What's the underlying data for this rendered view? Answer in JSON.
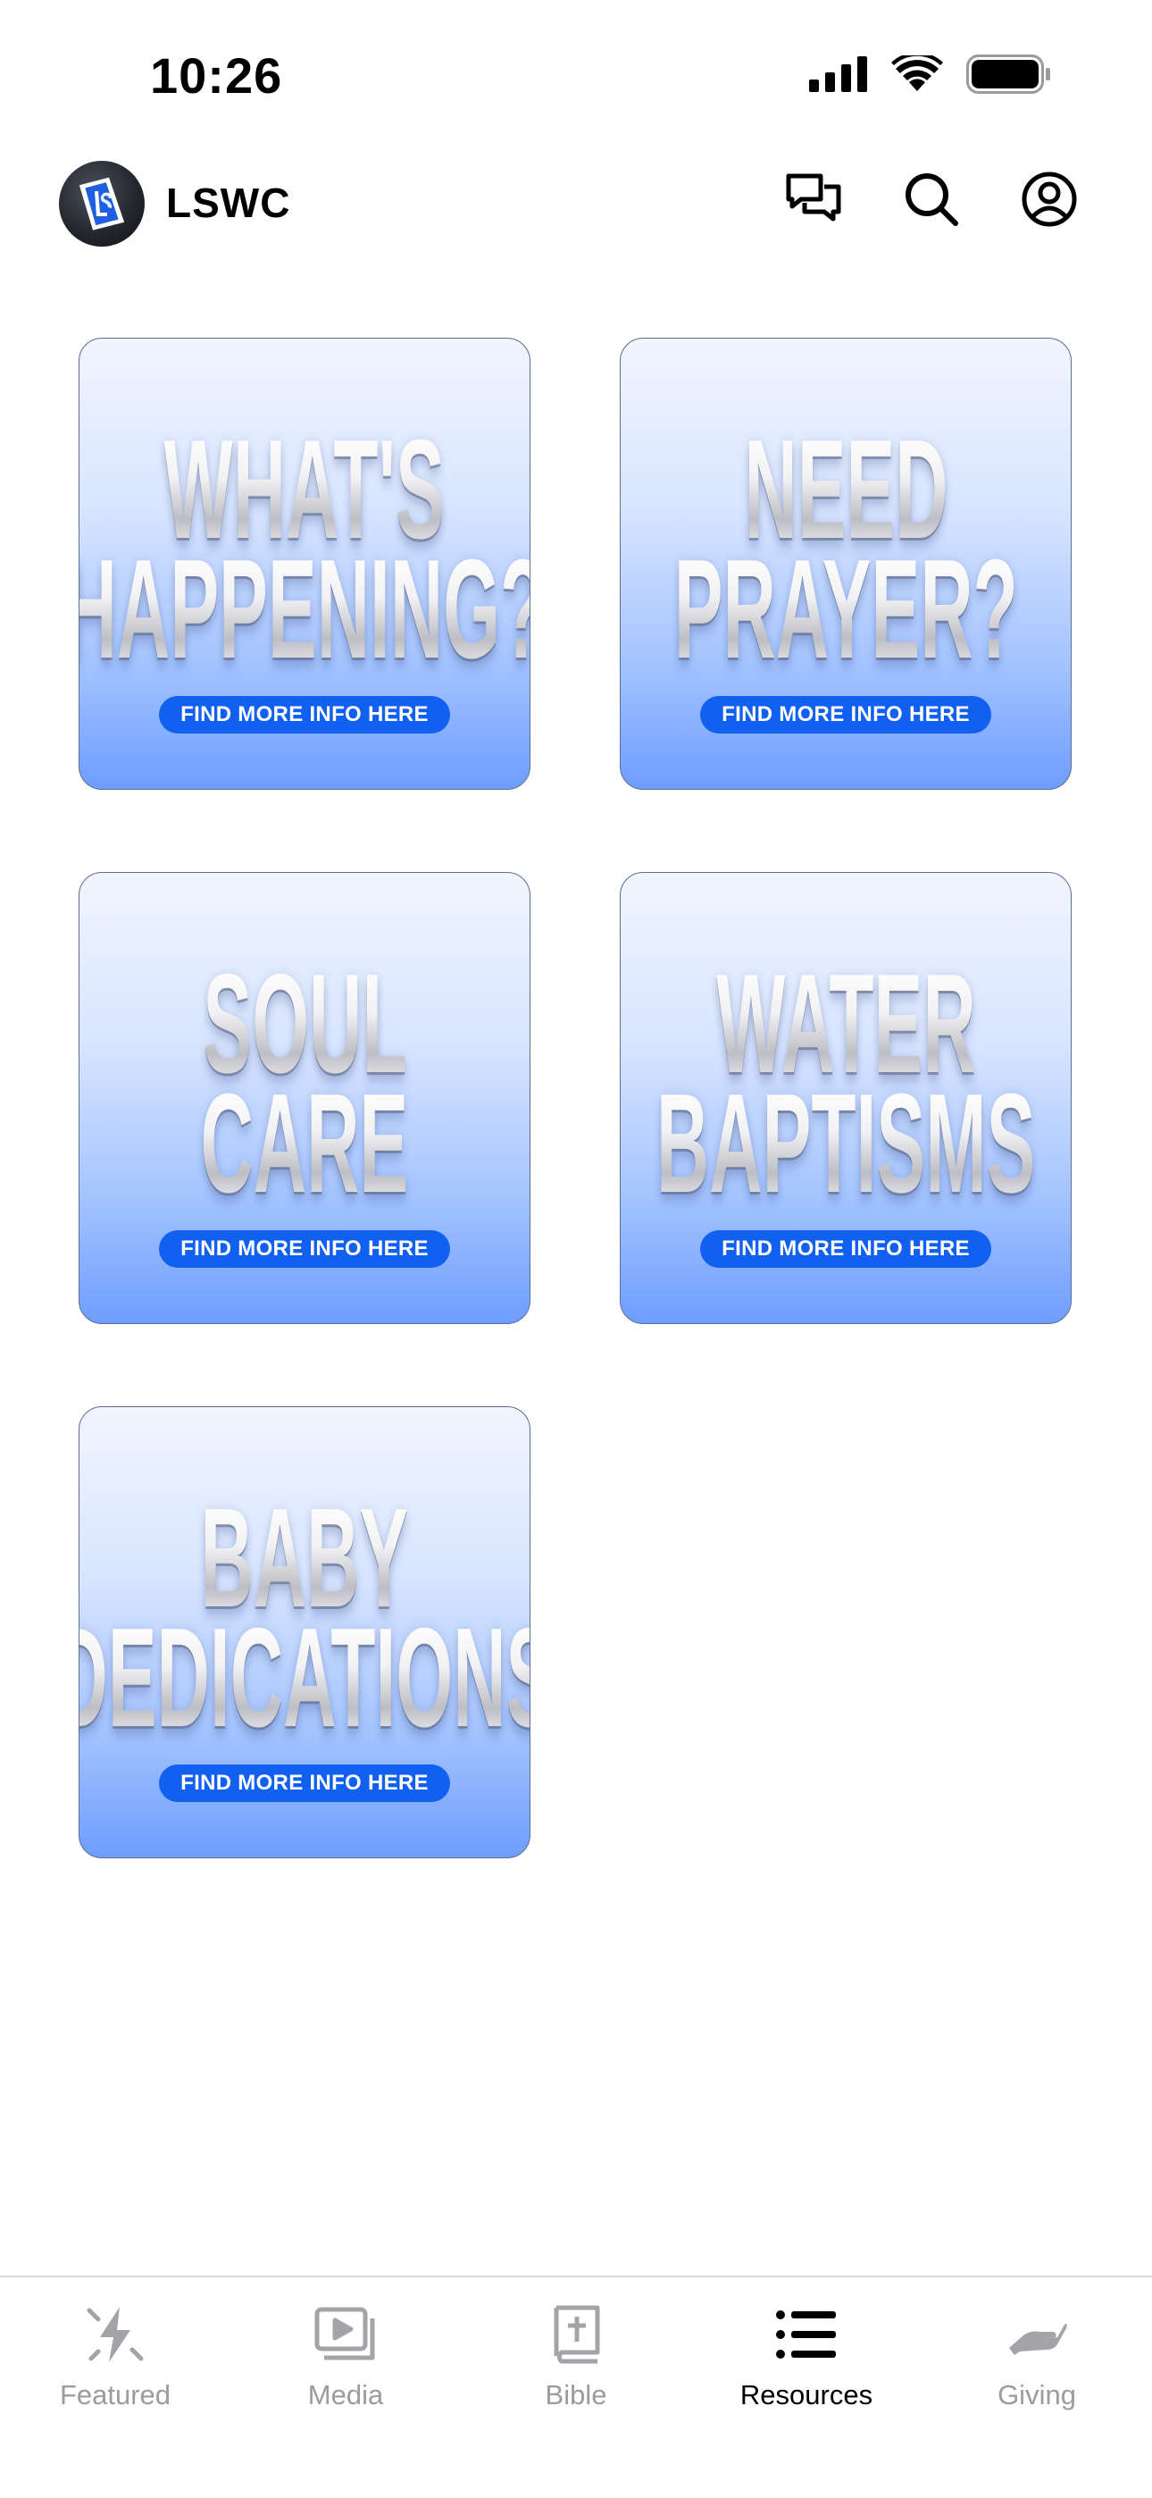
{
  "status_bar": {
    "time": "10:26"
  },
  "header": {
    "logo_icon": "lswc-logo-icon",
    "title": "LSWC",
    "actions": [
      {
        "name": "chat-icon"
      },
      {
        "name": "search-icon"
      },
      {
        "name": "profile-icon"
      }
    ]
  },
  "cards": [
    {
      "title_lines": [
        "WHAT'S",
        "HAPPENING?"
      ],
      "button_label": "FIND MORE INFO HERE"
    },
    {
      "title_lines": [
        "NEED",
        "PRAYER?"
      ],
      "button_label": "FIND MORE INFO HERE"
    },
    {
      "title_lines": [
        "SOUL",
        "CARE"
      ],
      "button_label": "FIND MORE INFO HERE"
    },
    {
      "title_lines": [
        "WATER",
        "BAPTISMS"
      ],
      "button_label": "FIND MORE INFO HERE"
    },
    {
      "title_lines": [
        "BABY",
        "DEDICATIONS"
      ],
      "button_label": "FIND MORE INFO HERE"
    }
  ],
  "tab_bar": {
    "tabs": [
      {
        "label": "Featured",
        "icon": "bolt-icon",
        "active": false
      },
      {
        "label": "Media",
        "icon": "media-icon",
        "active": false
      },
      {
        "label": "Bible",
        "icon": "bible-icon",
        "active": false
      },
      {
        "label": "Resources",
        "icon": "list-icon",
        "active": true
      },
      {
        "label": "Giving",
        "icon": "giving-hand-icon",
        "active": false
      }
    ]
  },
  "colors": {
    "accent_blue": "#1160f0",
    "tab_inactive": "#9b9ba0",
    "tab_active": "#000000"
  }
}
